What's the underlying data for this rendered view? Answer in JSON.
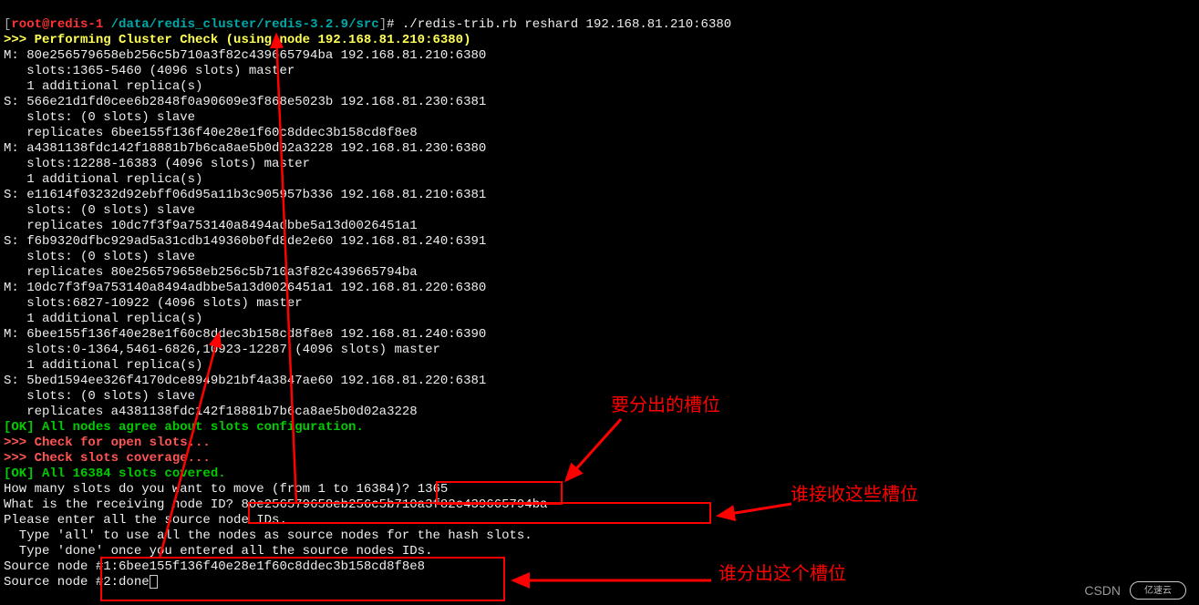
{
  "prompt": {
    "bracket_open": "[",
    "user": "root",
    "at": "@",
    "host": "redis-1",
    "path": " /data/redis_cluster/redis-3.2.9/src",
    "bracket_close": "]",
    "hash": "# ",
    "command": "./redis-trib.rb reshard 192.168.81.210:6380"
  },
  "lines": {
    "l1": ">>> Performing Cluster Check (using node 192.168.81.210:6380)",
    "l2": "M: 80e256579658eb256c5b710a3f82c439665794ba 192.168.81.210:6380",
    "l3": "   slots:1365-5460 (4096 slots) master",
    "l4": "   1 additional replica(s)",
    "l5": "S: 566e21d1fd0cee6b2848f0a90609e3f868e5023b 192.168.81.230:6381",
    "l6": "   slots: (0 slots) slave",
    "l7": "   replicates 6bee155f136f40e28e1f60c8ddec3b158cd8f8e8",
    "l8": "M: a4381138fdc142f18881b7b6ca8ae5b0d02a3228 192.168.81.230:6380",
    "l9": "   slots:12288-16383 (4096 slots) master",
    "l10": "   1 additional replica(s)",
    "l11": "S: e11614f03232d92ebff06d95a11b3c905957b336 192.168.81.210:6381",
    "l12": "   slots: (0 slots) slave",
    "l13": "   replicates 10dc7f3f9a753140a8494adbbe5a13d0026451a1",
    "l14": "S: f6b9320dfbc929ad5a31cdb149360b0fd8de2e60 192.168.81.240:6391",
    "l15": "   slots: (0 slots) slave",
    "l16": "   replicates 80e256579658eb256c5b710a3f82c439665794ba",
    "l17": "M: 10dc7f3f9a753140a8494adbbe5a13d0026451a1 192.168.81.220:6380",
    "l18": "   slots:6827-10922 (4096 slots) master",
    "l19": "   1 additional replica(s)",
    "l20": "M: 6bee155f136f40e28e1f60c8ddec3b158cd8f8e8 192.168.81.240:6390",
    "l21": "   slots:0-1364,5461-6826,10923-12287 (4096 slots) master",
    "l22": "   1 additional replica(s)",
    "l23": "S: 5bed1594ee326f4170dce8949b21bf4a3847ae60 192.168.81.220:6381",
    "l24": "   slots: (0 slots) slave",
    "l25": "   replicates a4381138fdc142f18881b7b6ca8ae5b0d02a3228",
    "l26": "[OK] All nodes agree about slots configuration.",
    "l27": ">>> Check for open slots...",
    "l28": ">>> Check slots coverage...",
    "l29": "[OK] All 16384 slots covered.",
    "l30a": "How many slots do you want to move (from 1 to 16384)? ",
    "l30b": "1365",
    "l31a": "What is the receiving node ID? ",
    "l31b": "80e256579658eb256c5b710a3f82c439665794ba",
    "l32": "Please enter all the source node IDs.",
    "l33": "  Type 'all' to use all the nodes as source nodes for the hash slots.",
    "l34": "  Type 'done' once you entered all the source nodes IDs.",
    "l35a": "Source node #1:",
    "l35b": "6bee155f136f40e28e1f60c8ddec3b158cd8f8e8",
    "l36a": "Source node #2:",
    "l36b": "done"
  },
  "annotations": {
    "a1": "要分出的槽位",
    "a2": "谁接收这些槽位",
    "a3": "谁分出这个槽位"
  },
  "watermark": {
    "label": "CSDN",
    "logo": "亿速云"
  }
}
